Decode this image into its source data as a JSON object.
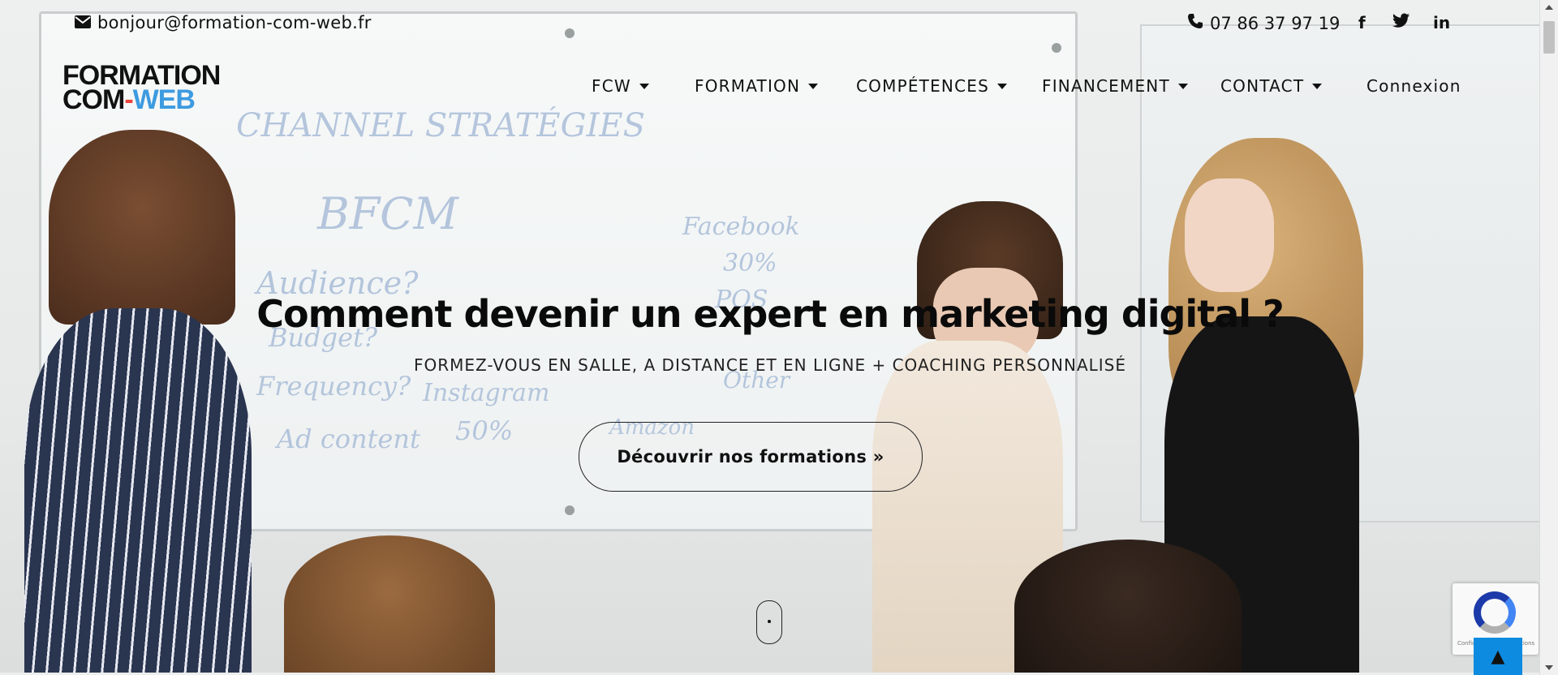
{
  "topbar": {
    "email": "bonjour@formation-com-web.fr",
    "phone": "07 86 37 97 19",
    "social": [
      {
        "name": "facebook",
        "glyph": "f"
      },
      {
        "name": "twitter",
        "glyph": "🐦"
      },
      {
        "name": "linkedin",
        "glyph": "in"
      }
    ]
  },
  "logo": {
    "line1": "FORMATION",
    "line2_com": "COM",
    "line2_dash": "-",
    "line2_web": "WEB",
    "colors": {
      "dark": "#111111",
      "dash": "#e8453c",
      "web": "#3d9be0"
    }
  },
  "nav": {
    "items": [
      {
        "label": "FCW",
        "has_dropdown": true
      },
      {
        "label": "FORMATION",
        "has_dropdown": true
      },
      {
        "label": "COMPÉTENCES",
        "has_dropdown": true
      },
      {
        "label": "FINANCEMENT",
        "has_dropdown": true
      },
      {
        "label": "CONTACT",
        "has_dropdown": true
      },
      {
        "label": "Connexion",
        "has_dropdown": false
      }
    ]
  },
  "hero": {
    "title": "Comment devenir un expert en marketing digital ?",
    "subtitle": "FORMEZ-VOUS EN SALLE, A DISTANCE ET EN LIGNE + COACHING PERSONNALISÉ",
    "cta_label": "Découvrir nos formations »",
    "board_scribbles": [
      "CHANNEL STRATÉGIES",
      "BFCM",
      "Audience?",
      "Budget?",
      "Frequency?",
      "Instagram",
      "Ad content",
      "50%",
      "Facebook",
      "30%",
      "POS",
      "Other",
      "Amazon"
    ]
  },
  "widgets": {
    "recaptcha_text": "Confidentialité - Conditions",
    "back_to_top_icon": "▲"
  },
  "colors": {
    "accent_blue": "#0d8be0",
    "text_dark": "#111111"
  }
}
